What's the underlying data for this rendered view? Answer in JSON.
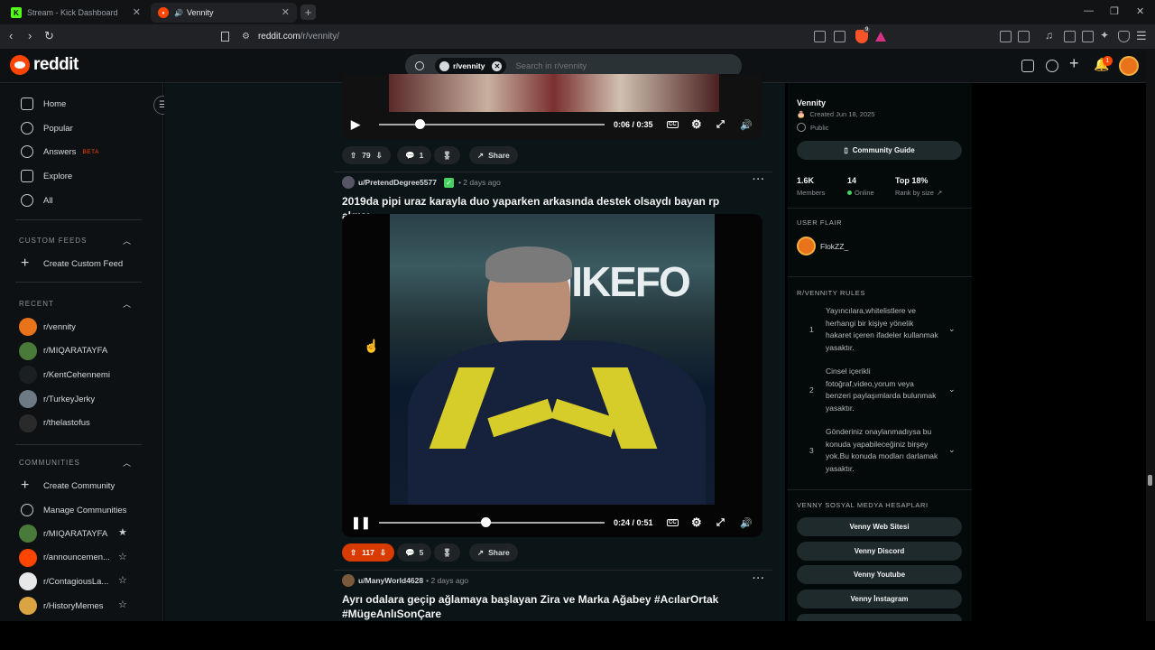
{
  "browser": {
    "tabs": [
      {
        "title": "Stream - Kick Dashboard",
        "active": false
      },
      {
        "title": "Vennity",
        "active": true
      }
    ],
    "url_domain": "reddit.com",
    "url_path": "/r/vennity/",
    "extension_count": "9"
  },
  "header": {
    "logo_text": "reddit",
    "search_chip": "r/vennity",
    "search_placeholder": "Search in r/vennity",
    "notification_count": "1"
  },
  "sidebar": {
    "nav": [
      {
        "label": "Home",
        "icon": "home-icon"
      },
      {
        "label": "Popular",
        "icon": "popular-icon"
      },
      {
        "label": "Answers",
        "icon": "answers-icon",
        "badge": "BETA"
      },
      {
        "label": "Explore",
        "icon": "explore-icon"
      },
      {
        "label": "All",
        "icon": "all-icon"
      }
    ],
    "custom_feeds_heading": "CUSTOM FEEDS",
    "create_custom_feed": "Create Custom Feed",
    "recent_heading": "RECENT",
    "recent": [
      {
        "label": "r/vennity",
        "color": "#e8731a"
      },
      {
        "label": "r/MIQARATAYFA",
        "color": "#4a7a3a"
      },
      {
        "label": "r/KentCehennemi",
        "color": "#1a1f22"
      },
      {
        "label": "r/TurkeyJerky",
        "color": "#6d7a86"
      },
      {
        "label": "r/thelastofus",
        "color": "#2a2a2a"
      }
    ],
    "communities_heading": "COMMUNITIES",
    "create_community": "Create Community",
    "manage_communities": "Manage Communities",
    "communities": [
      {
        "label": "r/MIQARATAYFA",
        "color": "#4a7a3a",
        "favorite": true
      },
      {
        "label": "r/announcemen...",
        "color": "#ff4500",
        "favorite": false
      },
      {
        "label": "r/ContagiousLa...",
        "color": "#e8e8e8",
        "favorite": false
      },
      {
        "label": "r/HistoryMemes",
        "color": "#d9a441",
        "favorite": false
      }
    ]
  },
  "feed": {
    "post1": {
      "time": "0:06 / 0:35",
      "progress": 0.18,
      "votes": "79",
      "comments": "1",
      "share": "Share"
    },
    "post2": {
      "author": "u/PretendDegree5577",
      "age": "• 2 days ago",
      "title": "2019da pipi uraz karayla duo yaparken arkasında destek olsaydı bayan rp algısı",
      "video_text": "NIKEFO",
      "time": "0:24 / 0:51",
      "progress": 0.47,
      "votes": "117",
      "comments": "5",
      "share": "Share"
    },
    "post3": {
      "author": "u/ManyWorld4628",
      "age": "• 2 days ago",
      "title": "Ayrı odalara geçip ağlamaya başlayan Zira ve Marka Ağabey #AcılarOrtak #MügeAnlıSonÇare"
    }
  },
  "community": {
    "name": "Vennity",
    "created": "Created Jun 18, 2025",
    "visibility": "Public",
    "guide_button": "Community Guide",
    "stats": [
      {
        "value": "1.6K",
        "label": "Members"
      },
      {
        "value": "14",
        "label": "Online"
      },
      {
        "value": "Top 18%",
        "label": "Rank by size"
      }
    ],
    "user_flair_heading": "USER FLAIR",
    "user_flair": "FlokZZ_",
    "rules_heading": "R/VENNITY RULES",
    "rules": [
      {
        "num": "1",
        "text": "Yayıncılara,whitelistlere ve herhangi bir kişiye yönelik hakaret içeren ifadeler kullanmak yasaktır."
      },
      {
        "num": "2",
        "text": "Cinsel içerikli fotoğraf,video,yorum veya benzeri paylaşımlarda bulunmak yasaktır."
      },
      {
        "num": "3",
        "text": "Gönderiniz onaylanmadıysa bu konuda yapabileceğiniz birşey yok.Bu konuda modları darlamak yasaktır."
      }
    ],
    "social_heading": "VENNY SOSYAL MEDYA HESAPLARI",
    "social_links": [
      "Venny Web Sitesi",
      "Venny Discord",
      "Venny Youtube",
      "Venny İnstagram"
    ]
  },
  "colors": {
    "accent": "#ff4500",
    "online": "#46d160",
    "upvote_active": "#d93a00"
  }
}
